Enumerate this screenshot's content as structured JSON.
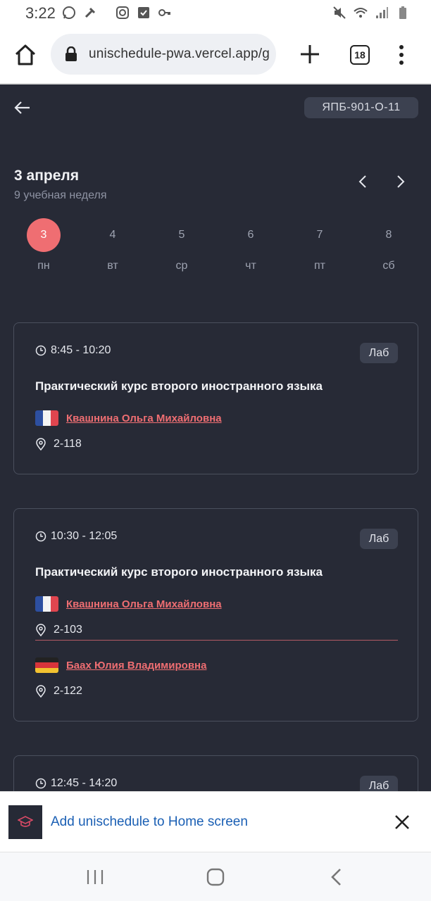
{
  "status_bar": {
    "time": "3:22"
  },
  "browser": {
    "url": "unischedule-pwa.vercel.app/g",
    "tab_count": "18"
  },
  "header": {
    "group": "ЯПБ-901-О-11"
  },
  "schedule": {
    "date_title": "3 апреля",
    "week_label": "9 учебная неделя",
    "days": [
      {
        "num": "3",
        "name": "пн",
        "active": true
      },
      {
        "num": "4",
        "name": "вт",
        "active": false
      },
      {
        "num": "5",
        "name": "ср",
        "active": false
      },
      {
        "num": "6",
        "name": "чт",
        "active": false
      },
      {
        "num": "7",
        "name": "пт",
        "active": false
      },
      {
        "num": "8",
        "name": "сб",
        "active": false
      }
    ]
  },
  "lessons": [
    {
      "time": "8:45 - 10:20",
      "type": "Лаб",
      "subject": "Практический курс второго иностранного языка",
      "teachers": [
        {
          "name": "Квашнина Ольга Михайловна",
          "flag": "france",
          "room": "2-118"
        }
      ]
    },
    {
      "time": "10:30 - 12:05",
      "type": "Лаб",
      "subject": "Практический курс второго иностранного языка",
      "teachers": [
        {
          "name": "Квашнина Ольга Михайловна",
          "flag": "france",
          "room": "2-103"
        },
        {
          "name": "Баах Юлия Владимировна",
          "flag": "germany",
          "room": "2-122"
        }
      ]
    },
    {
      "time": "12:45 - 14:20",
      "type": "Лаб"
    }
  ],
  "banner": {
    "text": "Add unischedule to Home screen"
  },
  "colors": {
    "accent": "#ef6e72",
    "background": "#272a36",
    "card_border": "#4a4f5d",
    "badge_bg": "#3c4150",
    "link_blue": "#1a5fb4"
  },
  "icons": [
    "home-icon",
    "lock-icon",
    "plus-icon",
    "tabs-icon",
    "more-vert-icon",
    "arrow-left-icon",
    "chevron-left-icon",
    "chevron-right-icon",
    "clock-icon",
    "location-pin-icon",
    "france-flag-icon",
    "germany-flag-icon",
    "graduation-cap-icon",
    "close-icon"
  ]
}
